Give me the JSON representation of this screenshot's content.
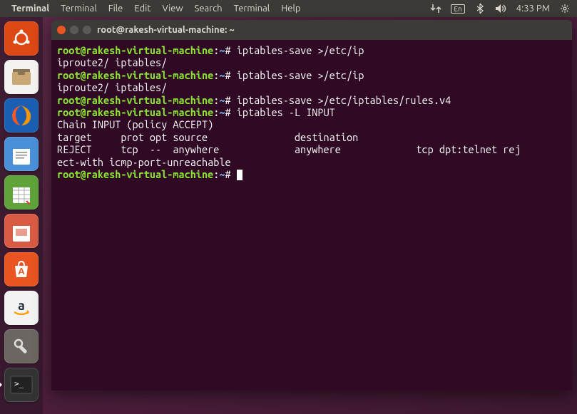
{
  "topbar": {
    "app": "Terminal",
    "menus": [
      "Terminal",
      "File",
      "Edit",
      "View",
      "Search",
      "Terminal",
      "Help"
    ],
    "lang": "En",
    "time": "4:33 PM"
  },
  "launcher": {
    "items": [
      {
        "name": "ubuntu-dash",
        "glyph": "ubuntu"
      },
      {
        "name": "files",
        "glyph": "folder"
      },
      {
        "name": "firefox",
        "glyph": "firefox"
      },
      {
        "name": "writer",
        "glyph": "doc"
      },
      {
        "name": "calc",
        "glyph": "sheet"
      },
      {
        "name": "impress",
        "glyph": "slides"
      },
      {
        "name": "software",
        "glyph": "bag"
      },
      {
        "name": "amazon",
        "glyph": "amazon"
      },
      {
        "name": "settings",
        "glyph": "wrench"
      },
      {
        "name": "terminal-app",
        "glyph": "term"
      }
    ]
  },
  "window": {
    "title": "root@rakesh-virtual-machine: ~"
  },
  "prompt": {
    "user_host": "root@rakesh-virtual-machine",
    "sep": ":",
    "path": "~",
    "hash": "#"
  },
  "lines": {
    "l1_cmd": "iptables-save >/etc/ip",
    "l2": "iproute2/ iptables/",
    "l3_cmd": "iptables-save >/etc/ip",
    "l4": "iproute2/ iptables/",
    "l5_cmd": "iptables-save >/etc/iptables/rules.v4",
    "l6_cmd": "iptables -L INPUT",
    "l7": "Chain INPUT (policy ACCEPT)",
    "l8": "target     prot opt source               destination",
    "l9": "REJECT     tcp  --  anywhere             anywhere             tcp dpt:telnet rej",
    "l10": "ect-with icmp-port-unreachable"
  }
}
